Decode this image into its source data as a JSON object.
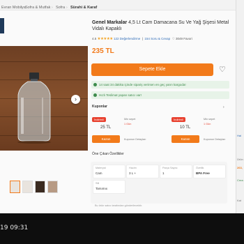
{
  "breadcrumb": [
    "Evran Mobilya",
    "Sofra & Mutfak",
    "Sofra",
    "Sürahi & Karaf"
  ],
  "brand": "Genel Markalar",
  "title_rest": "4,5 Lt Cam Damacana Su Ve Yağ Şişesi Metal Vidalı Kapaklı",
  "rating": {
    "score": "4.5",
    "review_count": "122 Değerlendirme",
    "qa_count": "154 Soru & Cevap",
    "fav_count": "3049 Favori"
  },
  "price": "235 TL",
  "add_to_cart": "Sepete Ekle",
  "info_banner_1": "14 saat 34 dakika içinde sipariş verirsen en geç yarın kargoda!",
  "info_banner_2": "Hızlı Teslimat yapan satıcı var!",
  "coupons": {
    "label": "Kuponlar",
    "items": [
      {
        "tag": "İndirimli",
        "amount": "25 TL",
        "min_label": "Min sepet",
        "min_value": "1 Gün",
        "btn": "Kazan",
        "note": "Kuponun Detayları"
      },
      {
        "tag": "İndirimli",
        "amount": "10 TL",
        "min_label": "Min sepet",
        "min_value": "1 Gün",
        "btn": "Kazan",
        "note": "Kuponun Detayları"
      }
    ]
  },
  "features": {
    "label": "Öne Çıkan Özellikler",
    "items": [
      {
        "k": "Materyal",
        "v": "Cam"
      },
      {
        "k": "Hacim",
        "v": "3 L +"
      },
      {
        "k": "Parça Sayısı",
        "v": "1"
      },
      {
        "k": "Özellik",
        "v": "BPA Free"
      },
      {
        "k": "Stil",
        "v": "Tarsımıx"
      }
    ]
  },
  "features_note": "Bu ürün satıcı tarafından gönderilecektir.",
  "right_panel": [
    "Hal",
    "Ürün",
    "263,",
    "Crea",
    "Kat"
  ],
  "clock": "19 09:31",
  "colors": {
    "accent": "#f27a1a",
    "success": "#3d8b4c",
    "link": "#2e6bb6",
    "coupon_red": "#e8412f"
  },
  "icons": {
    "favorite": "heart-icon",
    "next": "chevron-right-icon",
    "prev": "chevron-left-icon"
  }
}
